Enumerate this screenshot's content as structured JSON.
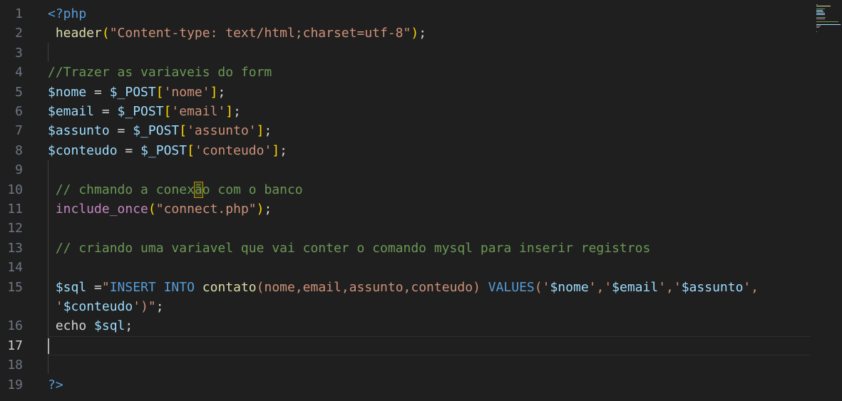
{
  "editor": {
    "language": "php",
    "current_line": 17,
    "lines": [
      {
        "n": "1",
        "tokens": [
          {
            "t": "<?php",
            "c": "tag"
          }
        ]
      },
      {
        "n": "2",
        "tokens": [
          {
            "t": " header",
            "c": "fn"
          },
          {
            "t": "(",
            "c": "brk1"
          },
          {
            "t": "\"Content-type: text/html;charset=utf-8\"",
            "c": "str"
          },
          {
            "t": ")",
            "c": "brk1"
          },
          {
            "t": ";",
            "c": "punc"
          }
        ]
      },
      {
        "n": "3",
        "tokens": []
      },
      {
        "n": "4",
        "tokens": [
          {
            "t": "//Trazer as variaveis do form",
            "c": "cmt"
          }
        ]
      },
      {
        "n": "5",
        "tokens": [
          {
            "t": "$nome",
            "c": "var"
          },
          {
            "t": " = ",
            "c": "punc"
          },
          {
            "t": "$_POST",
            "c": "var"
          },
          {
            "t": "[",
            "c": "brk1"
          },
          {
            "t": "'nome'",
            "c": "str"
          },
          {
            "t": "]",
            "c": "brk1"
          },
          {
            "t": ";",
            "c": "punc"
          }
        ]
      },
      {
        "n": "6",
        "tokens": [
          {
            "t": "$email",
            "c": "var"
          },
          {
            "t": " = ",
            "c": "punc"
          },
          {
            "t": "$_POST",
            "c": "var"
          },
          {
            "t": "[",
            "c": "brk1"
          },
          {
            "t": "'email'",
            "c": "str"
          },
          {
            "t": "]",
            "c": "brk1"
          },
          {
            "t": ";",
            "c": "punc"
          }
        ]
      },
      {
        "n": "7",
        "tokens": [
          {
            "t": "$assunto",
            "c": "var"
          },
          {
            "t": " = ",
            "c": "punc"
          },
          {
            "t": "$_POST",
            "c": "var"
          },
          {
            "t": "[",
            "c": "brk1"
          },
          {
            "t": "'assunto'",
            "c": "str"
          },
          {
            "t": "]",
            "c": "brk1"
          },
          {
            "t": ";",
            "c": "punc"
          }
        ]
      },
      {
        "n": "8",
        "tokens": [
          {
            "t": "$conteudo",
            "c": "var"
          },
          {
            "t": " = ",
            "c": "punc"
          },
          {
            "t": "$_POST",
            "c": "var"
          },
          {
            "t": "[",
            "c": "brk1"
          },
          {
            "t": "'conteudo'",
            "c": "str"
          },
          {
            "t": "]",
            "c": "brk1"
          },
          {
            "t": ";",
            "c": "punc"
          }
        ]
      },
      {
        "n": "9",
        "tokens": []
      },
      {
        "n": "10",
        "tokens": [
          {
            "t": " // chmando a conex",
            "c": "cmt"
          },
          {
            "t": "ã",
            "c": "cmt box"
          },
          {
            "t": "o com o banco",
            "c": "cmt"
          }
        ]
      },
      {
        "n": "11",
        "tokens": [
          {
            "t": " include_once",
            "c": "kw"
          },
          {
            "t": "(",
            "c": "brk1"
          },
          {
            "t": "\"connect.php\"",
            "c": "str"
          },
          {
            "t": ")",
            "c": "brk1"
          },
          {
            "t": ";",
            "c": "punc"
          }
        ]
      },
      {
        "n": "12",
        "tokens": []
      },
      {
        "n": "13",
        "tokens": [
          {
            "t": " // criando uma variavel que vai conter o comando mysql para inserir registros",
            "c": "cmt"
          }
        ]
      },
      {
        "n": "14",
        "tokens": []
      },
      {
        "n": "15",
        "tokens": [
          {
            "t": " $sql",
            "c": "var"
          },
          {
            "t": " =",
            "c": "punc"
          },
          {
            "t": "\"",
            "c": "str"
          },
          {
            "t": "INSERT INTO",
            "c": "sqlkw"
          },
          {
            "t": " contato",
            "c": "fn"
          },
          {
            "t": "(nome,email,assunto,conteudo) ",
            "c": "str"
          },
          {
            "t": "VALUES",
            "c": "sqlkw"
          },
          {
            "t": "('",
            "c": "str"
          },
          {
            "t": "$nome",
            "c": "var"
          },
          {
            "t": "','",
            "c": "str"
          },
          {
            "t": "$email",
            "c": "var"
          },
          {
            "t": "','",
            "c": "str"
          },
          {
            "t": "$assunto",
            "c": "var"
          },
          {
            "t": "',",
            "c": "str"
          }
        ]
      },
      {
        "n": "",
        "tokens": [
          {
            "t": " '",
            "c": "str"
          },
          {
            "t": "$conteudo",
            "c": "var"
          },
          {
            "t": "')\"",
            "c": "str"
          },
          {
            "t": ";",
            "c": "punc"
          }
        ]
      },
      {
        "n": "16",
        "tokens": [
          {
            "t": " echo",
            "c": "punc"
          },
          {
            "t": " $sql",
            "c": "var"
          },
          {
            "t": ";",
            "c": "punc"
          }
        ]
      },
      {
        "n": "17",
        "tokens": []
      },
      {
        "n": "18",
        "tokens": []
      },
      {
        "n": "19",
        "tokens": [
          {
            "t": "?>",
            "c": "tag"
          }
        ]
      }
    ]
  },
  "colors": {
    "background": "#1f1f1f",
    "string": "#ce9178",
    "comment": "#6a9955",
    "variable": "#9cdcfe",
    "keyword": "#c586c0",
    "tag": "#569cd6",
    "function": "#dcdcaa",
    "bracket": "#ffd700"
  }
}
